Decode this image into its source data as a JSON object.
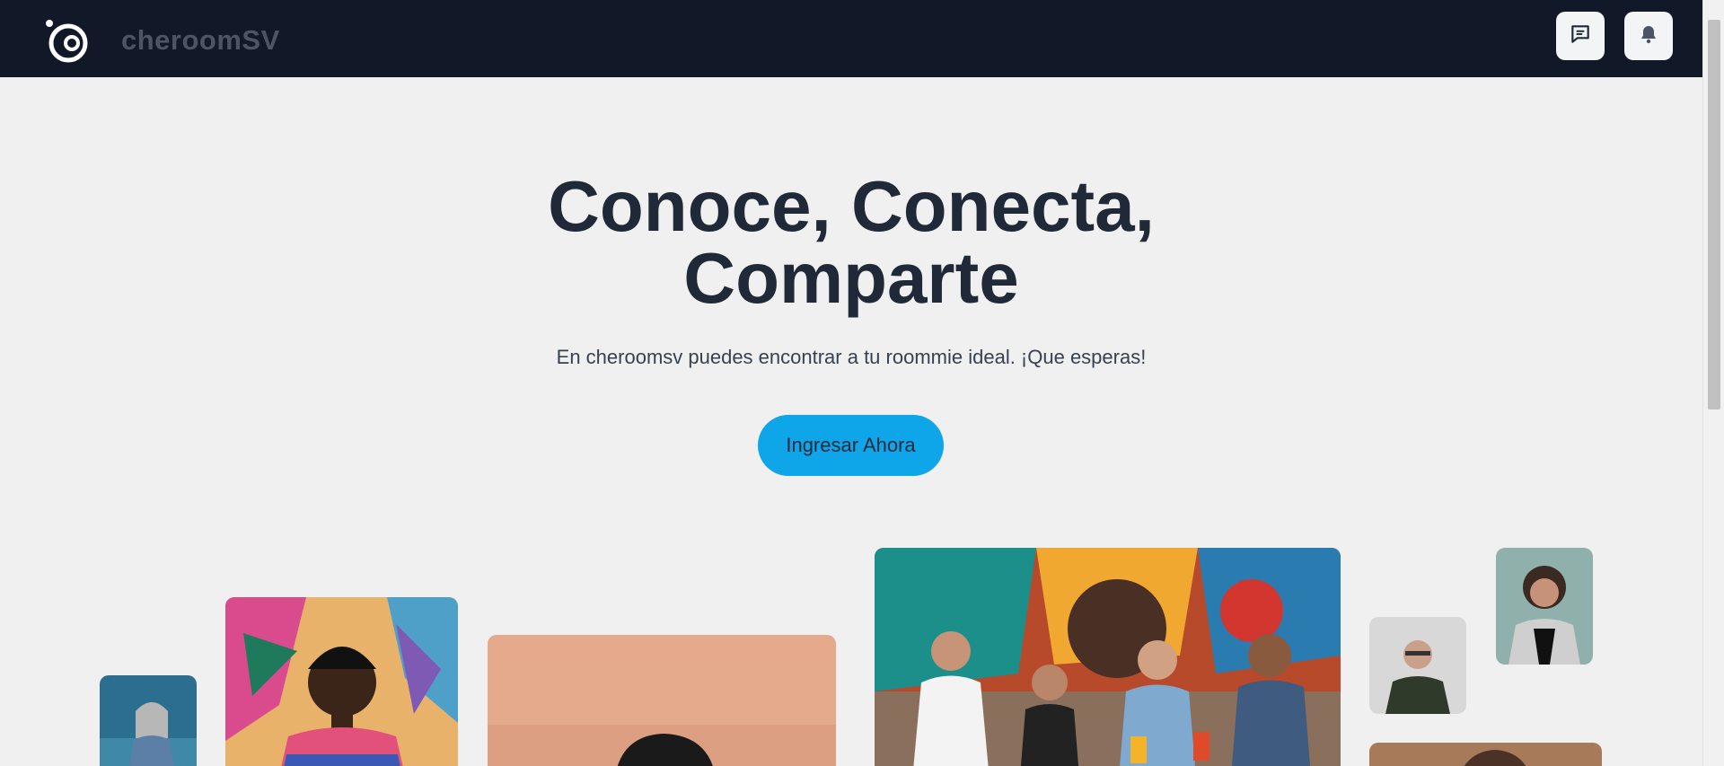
{
  "header": {
    "brand": "cheroomSV",
    "icons": {
      "logo": "planet-logo-icon",
      "messages": "chat-icon",
      "notifications": "bell-icon"
    }
  },
  "hero": {
    "title": "Conoce, Conecta, Comparte",
    "subtitle": "En cheroomsv puedes encontrar a tu roommie ideal. ¡Que esperas!",
    "cta_label": "Ingresar Ahora"
  },
  "colors": {
    "header_bg": "#111827",
    "page_bg": "#f0f0f0",
    "cta_bg": "#0ea5e9",
    "title": "#1f2937"
  }
}
